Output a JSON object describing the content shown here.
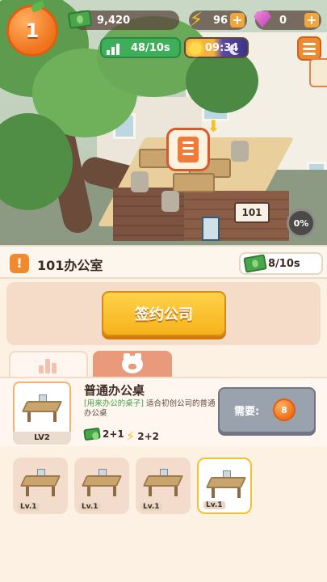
{
  "hud": {
    "level": "1",
    "cash": "9,420",
    "energy": "96",
    "gems": "0",
    "income_rate": "48/10s",
    "clock": "09:34"
  },
  "room": {
    "sign_number": "101",
    "title": "101办公室",
    "income": "8/10s",
    "progress": "0%"
  },
  "actions": {
    "sign_company": "签约公司"
  },
  "tabs": [
    "building",
    "staff"
  ],
  "item": {
    "name": "普通办公桌",
    "desc_tag": "[用来办公的桌子]",
    "desc_text": "适合初创公司的普通办公桌",
    "level": "LV2",
    "cash_bonus": "2+1",
    "energy_bonus": "2+2",
    "need_label": "需要:",
    "need_cost": "8"
  },
  "desks": [
    {
      "level": "Lv.1",
      "selected": false
    },
    {
      "level": "Lv.1",
      "selected": false
    },
    {
      "level": "Lv.1",
      "selected": false
    },
    {
      "level": "Lv.1",
      "selected": true
    }
  ],
  "colors": {
    "accent_orange": "#f08a2e",
    "button_yellow": "#f7b21c",
    "cash_green": "#3fae5a",
    "background": "#fdf1e3"
  }
}
